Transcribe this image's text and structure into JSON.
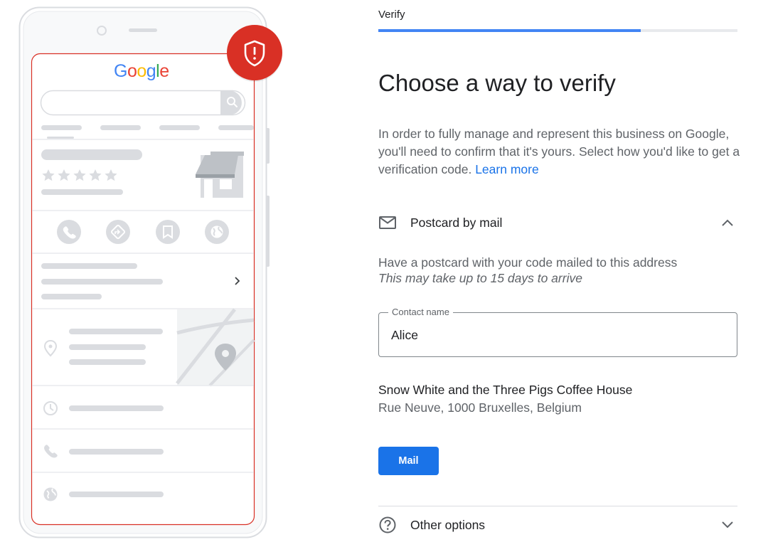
{
  "illustration": {
    "logo_text": "Google",
    "logo_colors": [
      "#4285f4",
      "#ea4335",
      "#fbbc05",
      "#4285f4",
      "#34a853",
      "#ea4335"
    ],
    "shield_color": "#d93025",
    "frame_color": "#dadce0",
    "highlight_border_color": "#d93025",
    "placeholder_color": "#dadce0"
  },
  "verify": {
    "step_label": "Verify",
    "progress_fraction": 0.73,
    "heading": "Choose a way to verify",
    "intro_text": "In order to fully manage and represent this business on Google, you'll need to confirm that it's yours. Select how you'd like to get a verification code.",
    "learn_more": "Learn more"
  },
  "postcard": {
    "icon": "envelope-icon",
    "title": "Postcard by mail",
    "expanded": true,
    "description": "Have a postcard with your code mailed to this address",
    "note": "This may take up to 15 days to arrive",
    "contact_label": "Contact name",
    "contact_value": "Alice",
    "business_name": "Snow White and the Three Pigs Coffee House",
    "business_address": "Rue Neuve, 1000 Bruxelles, Belgium",
    "mail_button": "Mail"
  },
  "other_options": {
    "icon": "help-circle-icon",
    "title": "Other options",
    "expanded": false
  },
  "colors": {
    "primary": "#1a73e8",
    "progress": "#4285f4",
    "text": "#202124",
    "secondary_text": "#5f6368"
  }
}
